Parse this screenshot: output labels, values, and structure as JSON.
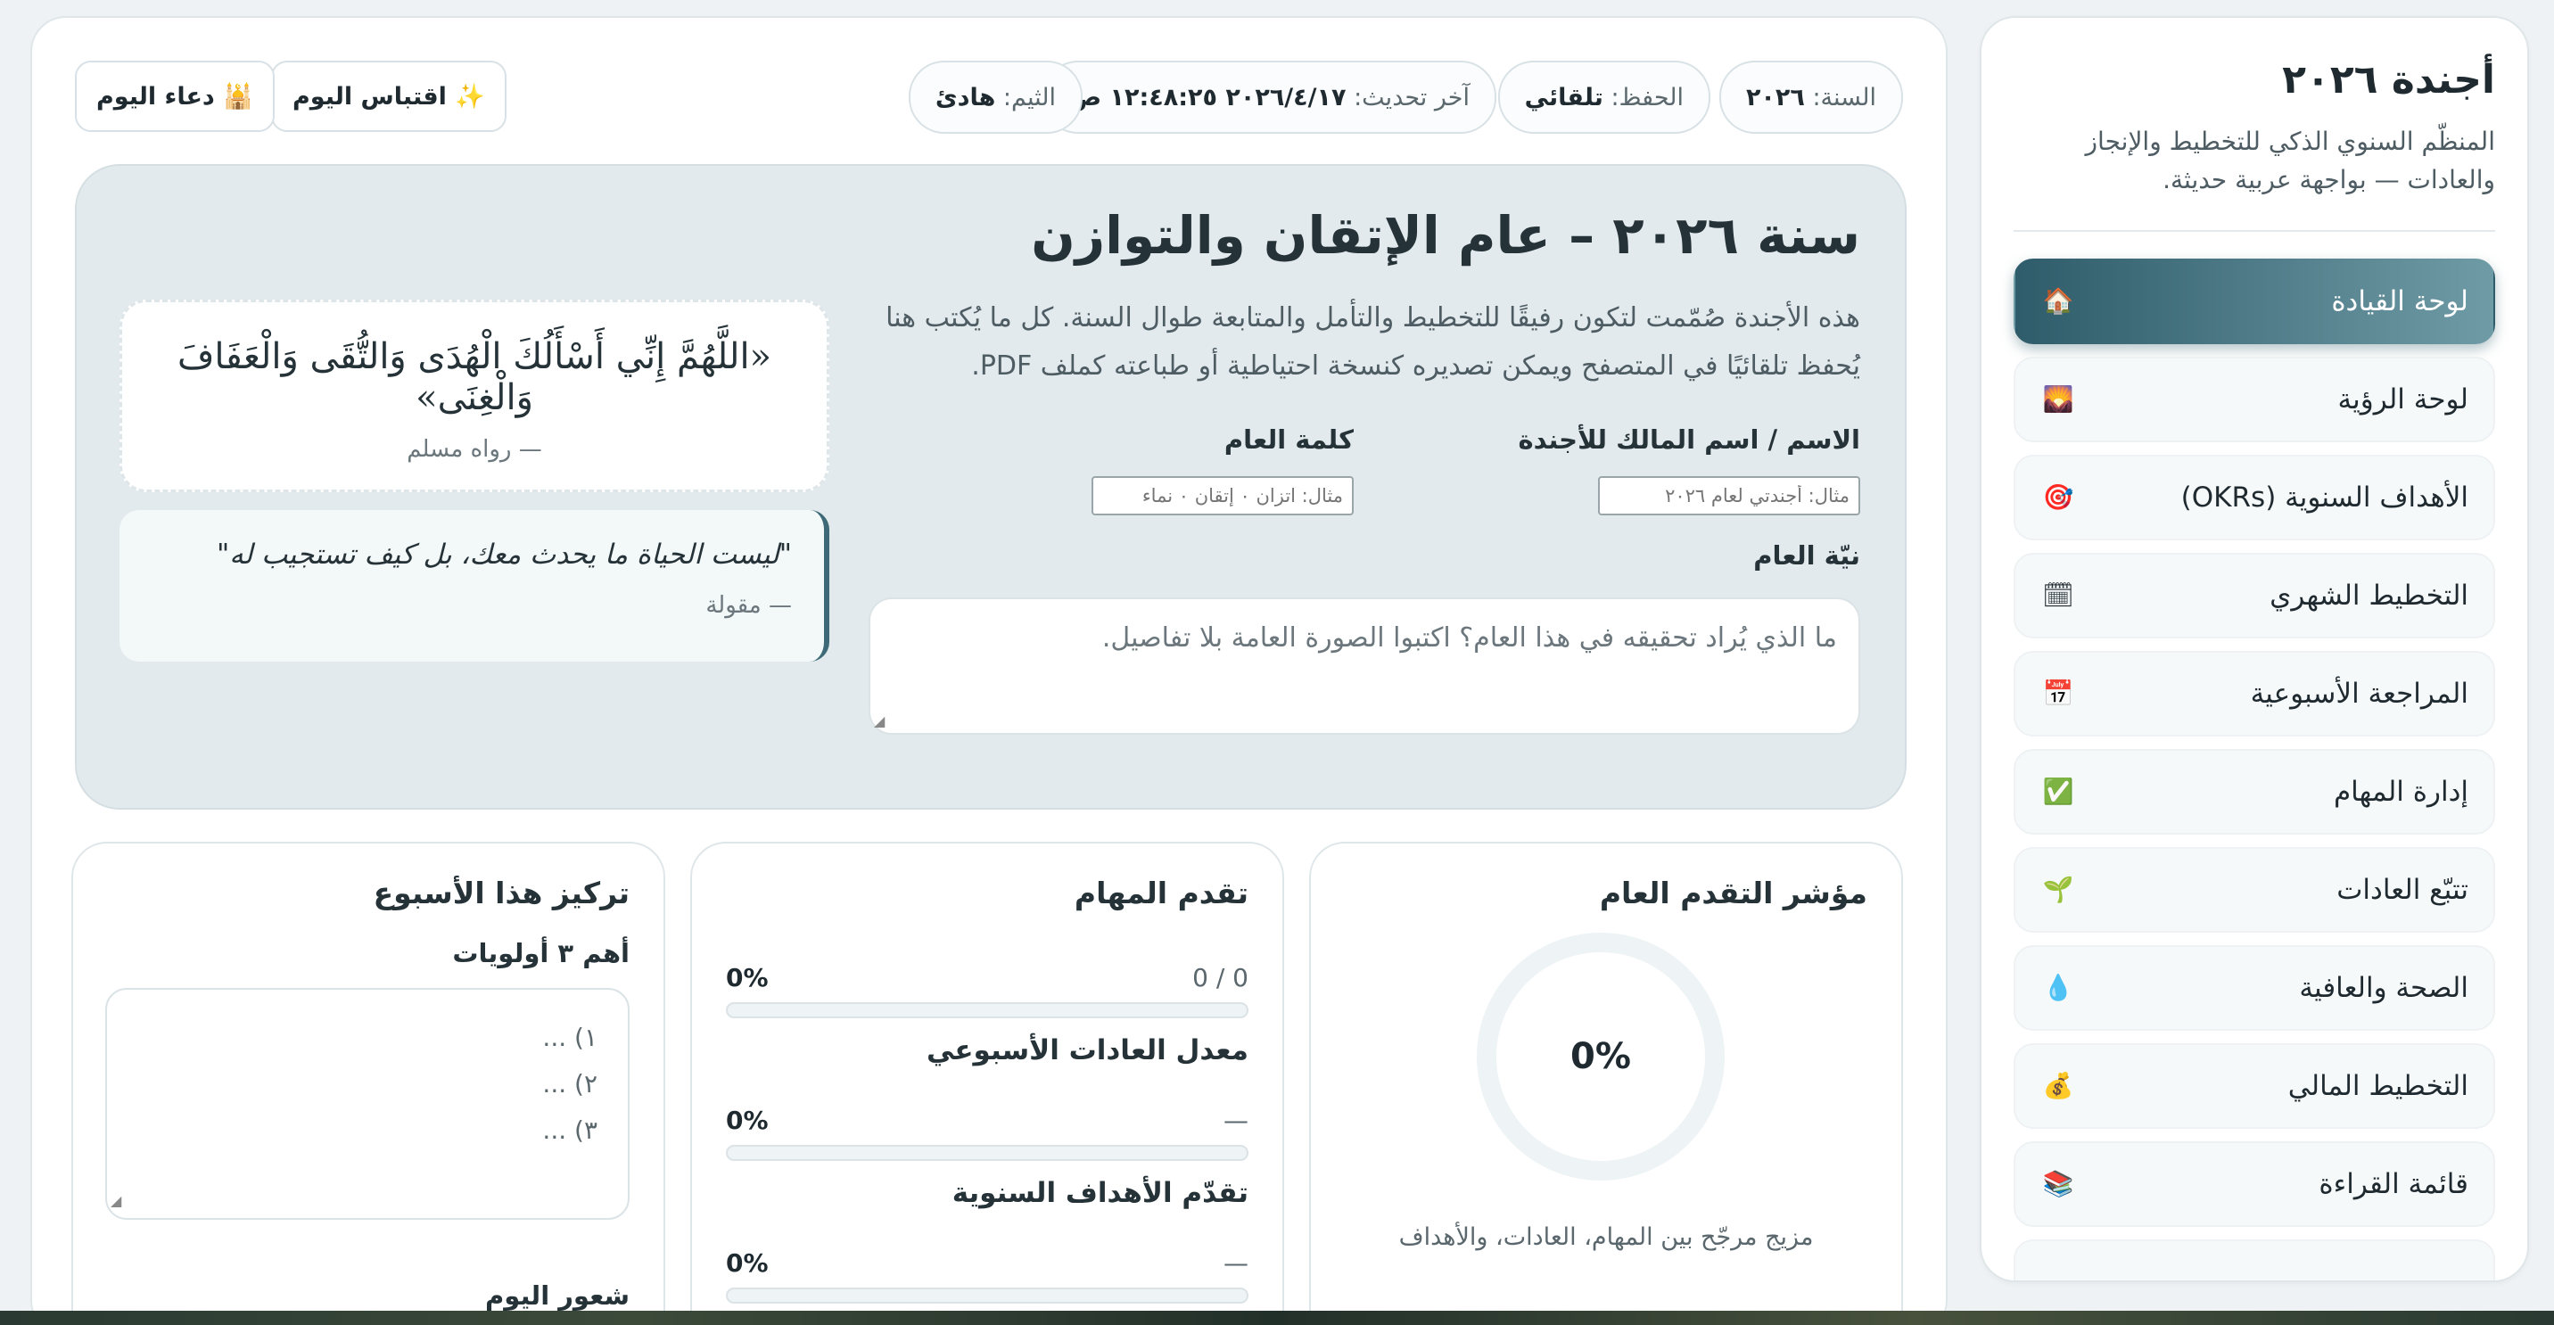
{
  "sidebar": {
    "title": "أجندة ٢٠٢٦",
    "subtitle": "المنظّم السنوي الذكي للتخطيط والإنجاز والعادات — بواجهة عربية حديثة.",
    "items": [
      {
        "label": "لوحة القيادة",
        "icon": "🏠"
      },
      {
        "label": "لوحة الرؤية",
        "icon": "🌄"
      },
      {
        "label": "الأهداف السنوية (OKRs)",
        "icon": "🎯"
      },
      {
        "label": "التخطيط الشهري",
        "icon": "🗓"
      },
      {
        "label": "المراجعة الأسبوعية",
        "icon": "📅"
      },
      {
        "label": "إدارة المهام",
        "icon": "✅"
      },
      {
        "label": "تتبّع العادات",
        "icon": "🌱"
      },
      {
        "label": "الصحة والعافية",
        "icon": "💧"
      },
      {
        "label": "التخطيط المالي",
        "icon": "💰"
      },
      {
        "label": "قائمة القراءة",
        "icon": "📚"
      }
    ]
  },
  "topbar": {
    "year_label": "السنة:",
    "year_value": "٢٠٢٦",
    "save_label": "الحفظ:",
    "save_value": "تلقائي",
    "updated_label": "آخر تحديث:",
    "updated_value": "٢٠٢٦/٤/١٧ ١٢:٤٨:٢٥ ص",
    "theme_label": "الثيم:",
    "theme_value": "هادئ",
    "quote_button": "✨ اقتباس اليوم",
    "dua_button": "🕌 دعاء اليوم"
  },
  "hero": {
    "title": "سنة ٢٠٢٦ – عام الإتقان والتوازن",
    "description": "هذه الأجندة صُمّمت لتكون رفيقًا للتخطيط والتأمل والمتابعة طوال السنة. كل ما يُكتب هنا يُحفظ تلقائيًا في المتصفح ويمكن تصديره كنسخة احتياطية أو طباعته كملف PDF.",
    "name_label": "الاسم / اسم المالك للأجندة",
    "name_placeholder": "مثال: أجندتي لعام ٢٠٢٦",
    "word_label": "كلمة العام",
    "word_placeholder": "مثال: اتزان ٠ إتقان ٠ نماء",
    "intent_label": "نيّة العام",
    "intent_placeholder": "ما الذي يُراد تحقيقه في هذا العام؟ اكتبوا الصورة العامة بلا تفاصيل.",
    "dua_text": "«اللَّهُمَّ إِنِّي أَسْأَلُكَ الْهُدَى وَالتُّقَى وَالْعَفَافَ وَالْغِنَى»",
    "dua_source": "— رواه مسلم",
    "quote_text": "\"ليست الحياة ما يحدث معك، بل كيف تستجيب له\"",
    "quote_source": "— مقولة"
  },
  "progress_card": {
    "title": "مؤشر التقدم العام",
    "value": "0%",
    "caption": "مزيج مرجّح بين المهام، العادات، والأهداف"
  },
  "tasks_card": {
    "title": "تقدم المهام",
    "tasks_pct": "0%",
    "tasks_count": "0 / 0",
    "tasks_fill": 0,
    "habits_label": "معدل العادات الأسبوعي",
    "habits_pct": "0%",
    "habits_count": "—",
    "habits_fill": 0,
    "goals_label": "تقدّم الأهداف السنوية",
    "goals_pct": "0%",
    "goals_count": "—",
    "goals_fill": 0
  },
  "focus_card": {
    "title": "تركيز هذا الأسبوع",
    "priorities_label": "أهم ٣ أولويات",
    "priority_1": "١) ...",
    "priority_2": "٢) ...",
    "priority_3": "٣) ...",
    "mood_label": "شعور اليوم"
  }
}
